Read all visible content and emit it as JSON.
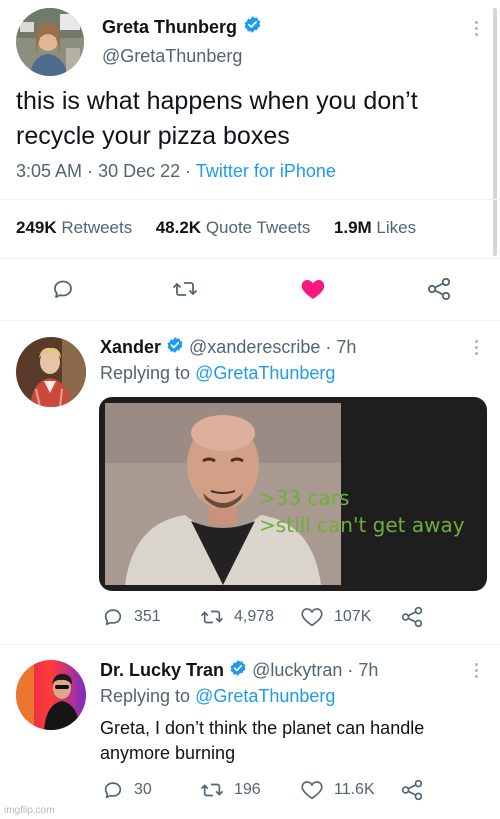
{
  "main_tweet": {
    "author_name": "Greta Thunberg",
    "author_handle": "@GretaThunberg",
    "text_line1": "this is what happens when you don’t",
    "text_line2": "recycle your pizza boxes",
    "time": "3:05 AM",
    "date": "30 Dec 22",
    "source": "Twitter for iPhone",
    "separator": "·",
    "retweets_count": "249K",
    "retweets_label": "Retweets",
    "quotes_count": "48.2K",
    "quotes_label": "Quote Tweets",
    "likes_count": "1.9M",
    "likes_label": "Likes"
  },
  "replies": [
    {
      "author_name": "Xander",
      "author_handle": "@xanderescribe",
      "age": "· 7h",
      "replying_prefix": "Replying to",
      "replying_to": "@GretaThunberg",
      "meme_line1": ">33 cars",
      "meme_line2": ">still can't get away",
      "reply_count": "351",
      "retweet_count": "4,978",
      "like_count": "107K"
    },
    {
      "author_name": "Dr. Lucky Tran",
      "author_handle": "@luckytran",
      "age": "· 7h",
      "replying_prefix": "Replying to",
      "replying_to": "@GretaThunberg",
      "text_line1": "Greta, I don’t think the planet can handle",
      "text_line2": "anymore burning",
      "reply_count": "30",
      "retweet_count": "196",
      "like_count": "11.6K"
    }
  ],
  "watermark": "imgflip.com",
  "colors": {
    "accent": "#1d9bf0",
    "like_active": "#f91880",
    "meme_green": "#6fae3b"
  },
  "icons": [
    "verified-badge-icon",
    "reply-icon",
    "retweet-icon",
    "like-icon",
    "share-icon",
    "more-icon"
  ]
}
